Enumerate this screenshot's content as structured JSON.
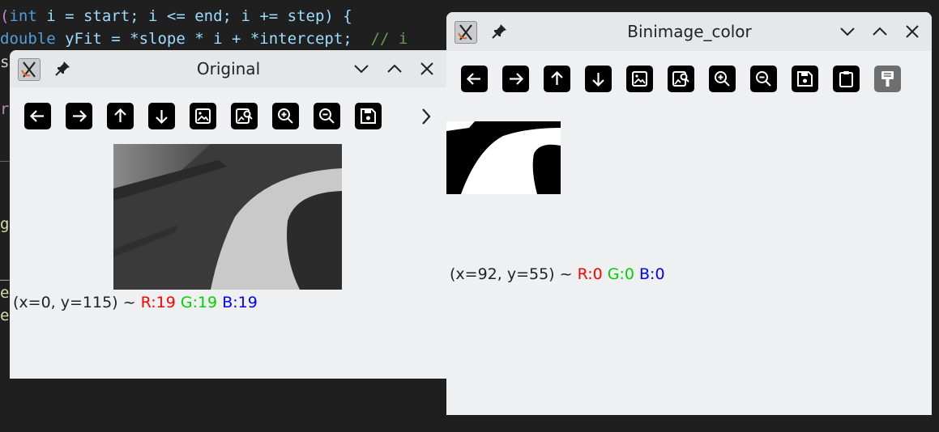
{
  "code": {
    "line1": {
      "open": "(",
      "kw_int": "int",
      "rest1": " i = start; i <= end; i += step) {"
    },
    "line2": {
      "kw_double": "double",
      "var": " yFit",
      "rest": " = *slope * i + *intercept;",
      "comment": "  // i"
    },
    "edge_chars": [
      "s",
      "r",
      "_",
      "g",
      "_",
      "e",
      "e"
    ]
  },
  "windows": {
    "original": {
      "title": "Original",
      "status": {
        "coords": "(x=0, y=115) ~ ",
        "r": "R:19",
        "g": "G:19",
        "b": "B:19"
      }
    },
    "binimage": {
      "title": "Binimage_color",
      "status": {
        "coords": "(x=92, y=55) ~ ",
        "r": "R:0",
        "g": "G:0",
        "b": "B:0"
      }
    }
  },
  "icons": {
    "toolbar": [
      "arrow-left-icon",
      "arrow-right-icon",
      "arrow-up-icon",
      "arrow-down-icon",
      "image-icon",
      "image-search-icon",
      "zoom-in-icon",
      "zoom-out-icon",
      "save-icon",
      "clipboard-icon",
      "brush-icon"
    ]
  },
  "colors": {
    "r": "#ff0000",
    "g": "#00d200",
    "b": "#0000ff",
    "background": "#1f1f1f",
    "window": "#eff0f1"
  }
}
